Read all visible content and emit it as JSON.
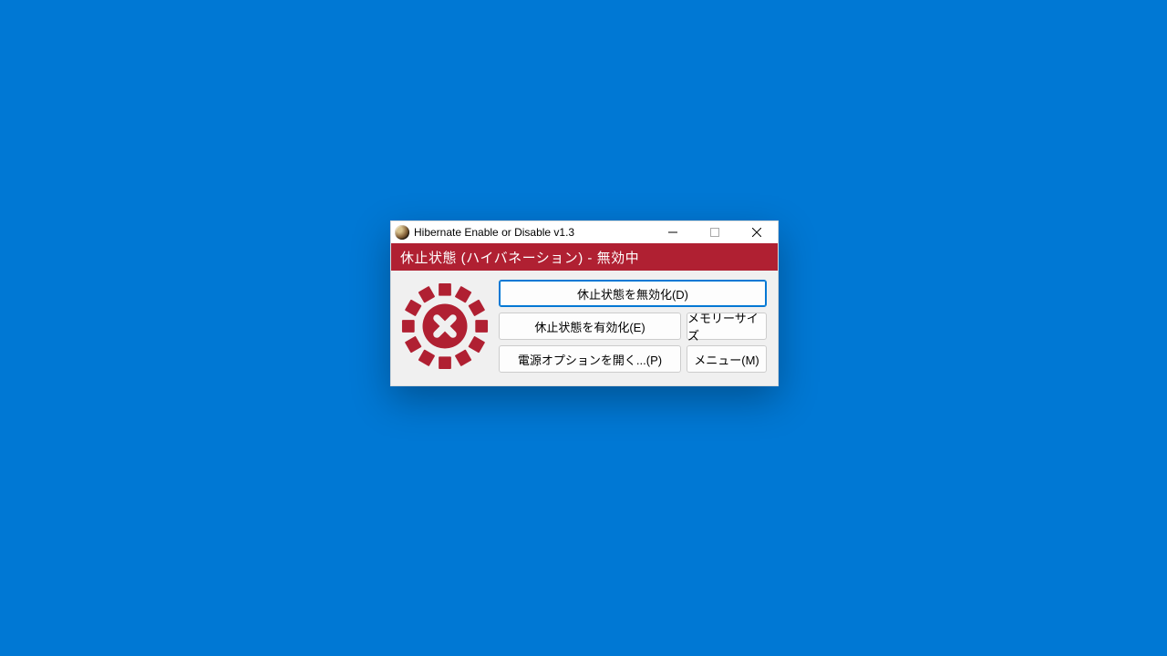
{
  "window": {
    "title": "Hibernate Enable or Disable v1.3"
  },
  "header": {
    "status_text": "休止状態 (ハイバネーション) - 無効中"
  },
  "buttons": {
    "disable": "休止状態を無効化(D)",
    "enable": "休止状態を有効化(E)",
    "memory_size": "メモリーサイズ",
    "power_options": "電源オプションを開く...(P)",
    "menu": "メニュー(M)"
  },
  "colors": {
    "accent": "#b02032",
    "desktop": "#0078d4"
  }
}
